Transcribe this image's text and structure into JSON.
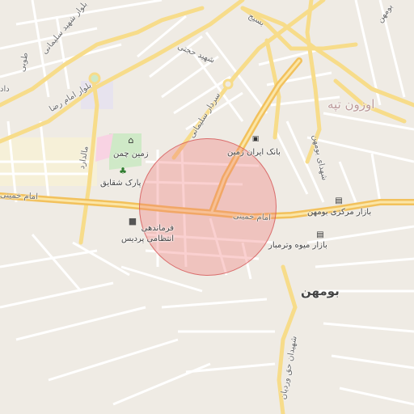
{
  "map": {
    "search_area_color": "#f07878",
    "districts": [
      {
        "name": "بومهن"
      },
      {
        "name": "اوزون تپه"
      }
    ],
    "streets": [
      {
        "name": "امام خمینی"
      },
      {
        "name": "امام خمینی"
      },
      {
        "name": "بلوار امام رضا"
      },
      {
        "name": "بلوار شهید سلیمانی"
      },
      {
        "name": "شهید حجتی"
      },
      {
        "name": "سردار سلیمانی"
      },
      {
        "name": "بسیج"
      },
      {
        "name": "شهدای بومهن"
      },
      {
        "name": "بومهن"
      },
      {
        "name": "شهیدان حق وردیان"
      },
      {
        "name": "طوبی"
      },
      {
        "name": "مالدارد"
      },
      {
        "name": "داد"
      }
    ],
    "pois": [
      {
        "name": "زمین چمن",
        "icon": "stadium-icon"
      },
      {
        "name": "پارک شقایق",
        "icon": "park-icon"
      },
      {
        "name": "فرماندهی انتظامی پردیس",
        "icon": "police-icon"
      },
      {
        "name": "بانک ایران زمین",
        "icon": "bank-icon"
      },
      {
        "name": "بازار مرکزی بومهن",
        "icon": "shopping-cart-icon"
      },
      {
        "name": "بازار میوه وترمبار",
        "icon": "shopping-cart-icon"
      }
    ]
  }
}
